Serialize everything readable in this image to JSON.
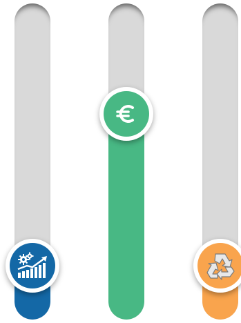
{
  "gauges": [
    {
      "id": "growth",
      "icon": "growth-chart-icon",
      "level": 0.17,
      "color": "#1468a6"
    },
    {
      "id": "euro",
      "icon": "euro-icon",
      "level": 0.65,
      "color": "#48b884",
      "symbol": "€"
    },
    {
      "id": "recycle",
      "icon": "recycle-icon",
      "level": 0.17,
      "color": "#f9a44d"
    }
  ]
}
